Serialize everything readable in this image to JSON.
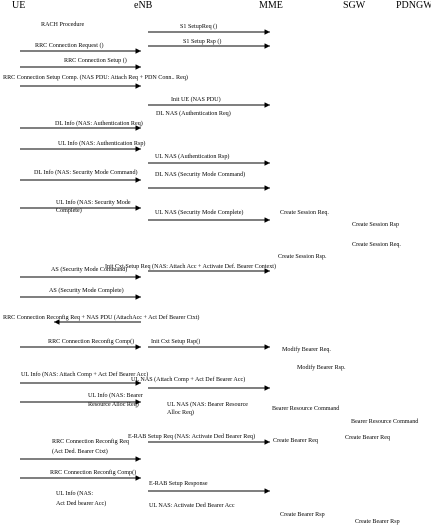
{
  "entities": [
    {
      "id": "ue",
      "name": "UE"
    },
    {
      "id": "enb",
      "name": "eNB"
    },
    {
      "id": "mme",
      "name": "MME"
    },
    {
      "id": "sgw",
      "name": "SGW"
    },
    {
      "id": "pdngw",
      "name": "PDNGW"
    }
  ],
  "messages": [
    {
      "id": "rach",
      "lines": [
        "RACH Procedure"
      ]
    },
    {
      "id": "s1setupreq",
      "lines": [
        "S1 SetupReq ()"
      ],
      "from": "enb",
      "to": "mme"
    },
    {
      "id": "s1setuprsp",
      "lines": [
        "S1 Setup Rsp ()"
      ],
      "from": "enb",
      "to": "mme"
    },
    {
      "id": "rrcconnreq",
      "lines": [
        "RRC Connection Request ()"
      ],
      "from": "ue",
      "to": "enb"
    },
    {
      "id": "rrcconnsetup",
      "lines": [
        "RRC Connection Setup ()"
      ],
      "from": "ue",
      "to": "enb"
    },
    {
      "id": "rrcsetupcomp",
      "lines": [
        "RRC Connection Setup Comp. (NAS PDU: Attach Req + PDN Conn.. Req)"
      ],
      "from": "ue",
      "to": "enb"
    },
    {
      "id": "initue",
      "lines": [
        "Init UE (NAS PDU)"
      ],
      "from": "enb",
      "to": "mme"
    },
    {
      "id": "dlnasauthreq",
      "lines": [
        "DL NAS (Authentication Req)"
      ],
      "from": "enb",
      "to": "mme"
    },
    {
      "id": "dlinfoauthreq",
      "lines": [
        "DL Info (NAS: Authentication Req)"
      ],
      "from": "ue",
      "to": "enb"
    },
    {
      "id": "ulinfoauthrsp",
      "lines": [
        "UL Info (NAS: Authentication Rsp)"
      ],
      "from": "ue",
      "to": "enb"
    },
    {
      "id": "ulnasauthrsp",
      "lines": [
        "UL NAS (Authentication Rsp)"
      ],
      "from": "enb",
      "to": "mme"
    },
    {
      "id": "dlnassmc",
      "lines": [
        "DL NAS (Security Mode Command)"
      ],
      "from": "enb",
      "to": "mme"
    },
    {
      "id": "dlinfosmc",
      "lines": [
        "DL Info (NAS: Security Mode Command)"
      ],
      "from": "ue",
      "to": "enb"
    },
    {
      "id": "ulinfosmc",
      "lines": [
        "UL Info (NAS: Security Mode",
        "Complete)"
      ],
      "from": "ue",
      "to": "enb"
    },
    {
      "id": "ulnassmc",
      "lines": [
        "UL NAS (Security Mode Complete)"
      ],
      "from": "enb",
      "to": "mme"
    },
    {
      "id": "createsessreq1",
      "lines": [
        "Create Session Req."
      ]
    },
    {
      "id": "createsessrsp1",
      "lines": [
        "Create Session Rsp"
      ]
    },
    {
      "id": "createsessreq2",
      "lines": [
        "Create Session Req."
      ]
    },
    {
      "id": "createsessrsp2",
      "lines": [
        "Create Session Rsp."
      ]
    },
    {
      "id": "initctxtsetup",
      "lines": [
        "Init Cxt Setup Req (NAS: Attach Acc + Activate Def. Bearer Context)"
      ],
      "from": "enb",
      "to": "mme"
    },
    {
      "id": "assmc",
      "lines": [
        "AS (Security Mode Command)"
      ],
      "from": "ue",
      "to": "enb"
    },
    {
      "id": "assmcomp",
      "lines": [
        "AS (Security Mode Complete)"
      ],
      "from": "ue",
      "to": "enb"
    },
    {
      "id": "rrcreconfreq1",
      "lines": [
        "RRC Connection Reconfig Req + NAS PDU (AttachAcc + Act Def Bearer Ctxt)"
      ],
      "from": "ue",
      "to": "enb"
    },
    {
      "id": "rrcreconfcomp1",
      "lines": [
        "RRC Connection Reconfig Comp()"
      ],
      "from": "ue",
      "to": "enb"
    },
    {
      "id": "initctxtsetuprsp",
      "lines": [
        "Init Cxt Setup Rsp()"
      ],
      "from": "enb",
      "to": "mme"
    },
    {
      "id": "modbearerreq",
      "lines": [
        "Modify Bearer Req."
      ]
    },
    {
      "id": "modbearerrsp",
      "lines": [
        "Modify Bearer Rsp."
      ]
    },
    {
      "id": "ulinfoattachcomp",
      "lines": [
        "UL Info (NAS: Attach Comp + Act Def Bearer Acc)"
      ],
      "from": "ue",
      "to": "enb"
    },
    {
      "id": "ulnasattachcomp",
      "lines": [
        "UL NAS (Attach Comp + Act Def Bearer Acc)"
      ],
      "from": "enb",
      "to": "mme"
    },
    {
      "id": "ulinfobra",
      "lines": [
        "UL Info (NAS: Bearer",
        "Resource Alloc Req)"
      ],
      "from": "ue",
      "to": "enb"
    },
    {
      "id": "ulnasbra",
      "lines": [
        "UL NAS (NAS: Bearer Resource",
        "Alloc Req)"
      ],
      "from": "enb",
      "to": "mme"
    },
    {
      "id": "brcmd1",
      "lines": [
        "Bearer Resource Command"
      ]
    },
    {
      "id": "brcmd2",
      "lines": [
        "Bearer Resource Command"
      ]
    },
    {
      "id": "erabsetupreq",
      "lines": [
        "E-RAB Setup Req (NAS: Activate Ded Bearer Req)"
      ],
      "from": "enb",
      "to": "mme"
    },
    {
      "id": "createbearerreq1",
      "lines": [
        "Create Bearer Req"
      ]
    },
    {
      "id": "createbearerreq2",
      "lines": [
        "Create Bearer Req"
      ]
    },
    {
      "id": "rrcreconfreq2",
      "lines": [
        "RRC Connection Reconfig Req",
        "(Act Ded. Bearer Ctxt)"
      ],
      "from": "ue",
      "to": "enb"
    },
    {
      "id": "rrcreconfcomp2",
      "lines": [
        "RRC Connection Reconfig Comp()"
      ],
      "from": "ue",
      "to": "enb"
    },
    {
      "id": "erabsetuprsp",
      "lines": [
        "E-RAB Setup Response"
      ],
      "from": "enb",
      "to": "mme"
    },
    {
      "id": "ulinfodedacc",
      "lines": [
        "UL Info (NAS:",
        "Act Ded bearer Acc)"
      ],
      "from": "ue",
      "to": "enb"
    },
    {
      "id": "ulnasdedacc",
      "lines": [
        "UL NAS: Activate Ded Bearer Acc"
      ],
      "from": "enb",
      "to": "mme"
    },
    {
      "id": "createbearerrsp1",
      "lines": [
        "Create Bearer Rsp"
      ]
    },
    {
      "id": "createbearerrsp2",
      "lines": [
        "Create Bearer Rsp"
      ]
    }
  ]
}
